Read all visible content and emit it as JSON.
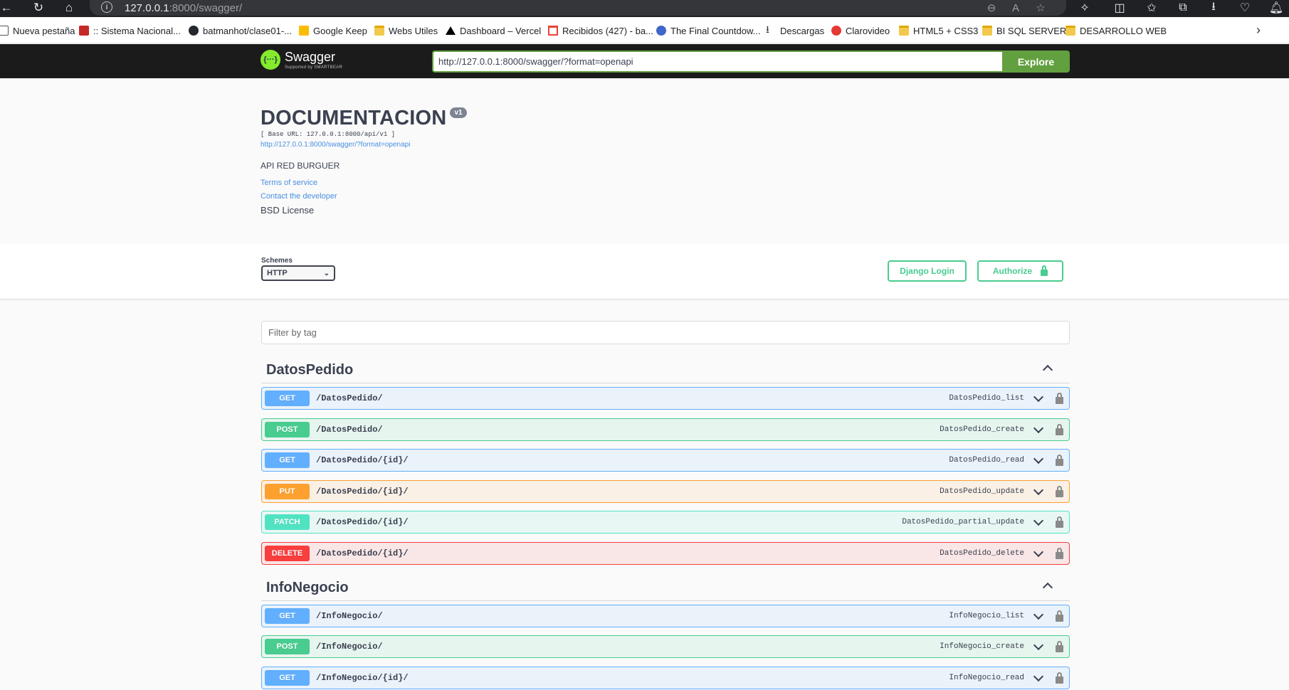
{
  "browser": {
    "url_host": "127.0.0.1",
    "url_rest": ":8000/swagger/",
    "bookmarks": [
      {
        "label": "Nueva pestaña",
        "icon": "page-icon"
      },
      {
        "label": ":: Sistema Nacional...",
        "icon": "mtc-icon"
      },
      {
        "label": "batmanhot/clase01-...",
        "icon": "github-icon"
      },
      {
        "label": "Google Keep",
        "icon": "keep-icon"
      },
      {
        "label": "Webs Utiles",
        "icon": "folder-icon"
      },
      {
        "label": "Dashboard – Vercel",
        "icon": "vercel-icon"
      },
      {
        "label": "Recibidos (427) - ba...",
        "icon": "gmail-icon"
      },
      {
        "label": "The Final Countdow...",
        "icon": "globe-icon"
      },
      {
        "label": "Descargas",
        "icon": "download-icon"
      },
      {
        "label": "Clarovideo",
        "icon": "claro-icon"
      },
      {
        "label": "HTML5 + CSS3",
        "icon": "folder-icon"
      },
      {
        "label": "BI SQL SERVER",
        "icon": "folder-icon"
      },
      {
        "label": "DESARROLLO WEB",
        "icon": "folder-icon"
      }
    ]
  },
  "topbar": {
    "logo_name": "Swagger",
    "logo_sub": "Supported by SMARTBEAR",
    "spec_url": "http://127.0.0.1:8000/swagger/?format=openapi",
    "explore_label": "Explore"
  },
  "info": {
    "title": "DOCUMENTACION",
    "version": "v1",
    "base_url": "[ Base URL: 127.0.0.1:8000/api/v1 ]",
    "spec_link": "http://127.0.0.1:8000/swagger/?format=openapi",
    "description": "API RED BURGUER",
    "terms": "Terms of service",
    "contact": "Contact the developer",
    "license": "BSD License"
  },
  "schemes": {
    "label": "Schemes",
    "selected": "HTTP",
    "django_login": "Django Login",
    "authorize": "Authorize"
  },
  "filter": {
    "placeholder": "Filter by tag"
  },
  "tags": [
    {
      "name": "DatosPedido",
      "operations": [
        {
          "method": "GET",
          "path": "/DatosPedido/",
          "operation_id": "DatosPedido_list"
        },
        {
          "method": "POST",
          "path": "/DatosPedido/",
          "operation_id": "DatosPedido_create"
        },
        {
          "method": "GET",
          "path": "/DatosPedido/{id}/",
          "operation_id": "DatosPedido_read"
        },
        {
          "method": "PUT",
          "path": "/DatosPedido/{id}/",
          "operation_id": "DatosPedido_update"
        },
        {
          "method": "PATCH",
          "path": "/DatosPedido/{id}/",
          "operation_id": "DatosPedido_partial_update"
        },
        {
          "method": "DELETE",
          "path": "/DatosPedido/{id}/",
          "operation_id": "DatosPedido_delete"
        }
      ]
    },
    {
      "name": "InfoNegocio",
      "operations": [
        {
          "method": "GET",
          "path": "/InfoNegocio/",
          "operation_id": "InfoNegocio_list"
        },
        {
          "method": "POST",
          "path": "/InfoNegocio/",
          "operation_id": "InfoNegocio_create"
        },
        {
          "method": "GET",
          "path": "/InfoNegocio/{id}/",
          "operation_id": "InfoNegocio_read"
        }
      ]
    }
  ],
  "colors": {
    "get": "#61affe",
    "post": "#49cc90",
    "put": "#fca130",
    "patch": "#50e3c2",
    "delete": "#f93e3e",
    "explore": "#62a03f",
    "link": "#4990e2"
  }
}
